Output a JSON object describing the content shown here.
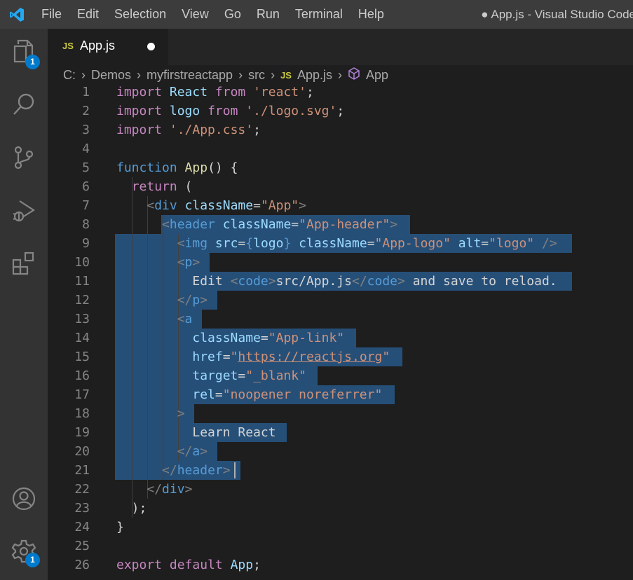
{
  "window": {
    "title": "● App.js - Visual Studio Code",
    "menu": [
      "File",
      "Edit",
      "Selection",
      "View",
      "Go",
      "Run",
      "Terminal",
      "Help"
    ]
  },
  "activity_bar": {
    "explorer_badge": "1",
    "settings_badge": "1",
    "icons": [
      "files-icon",
      "search-icon",
      "source-control-icon",
      "run-debug-icon",
      "extensions-icon",
      "account-icon",
      "gear-icon"
    ]
  },
  "tab": {
    "file_icon": "JS",
    "label": "App.js",
    "dirty": true
  },
  "breadcrumb": {
    "parts": [
      "C:",
      "Demos",
      "myfirstreactapp",
      "src"
    ],
    "file_icon": "JS",
    "file": "App.js",
    "symbol": "App"
  },
  "editor": {
    "selection_start_line": 8,
    "selection_end_line": 21,
    "lines": [
      {
        "n": "1"
      },
      {
        "n": "2"
      },
      {
        "n": "3"
      },
      {
        "n": "4"
      },
      {
        "n": "5"
      },
      {
        "n": "6"
      },
      {
        "n": "7"
      },
      {
        "n": "8"
      },
      {
        "n": "9"
      },
      {
        "n": "10"
      },
      {
        "n": "11"
      },
      {
        "n": "12"
      },
      {
        "n": "13"
      },
      {
        "n": "14"
      },
      {
        "n": "15"
      },
      {
        "n": "16"
      },
      {
        "n": "17"
      },
      {
        "n": "18"
      },
      {
        "n": "19"
      },
      {
        "n": "20"
      },
      {
        "n": "21"
      },
      {
        "n": "22"
      },
      {
        "n": "23"
      },
      {
        "n": "24"
      },
      {
        "n": "25"
      },
      {
        "n": "26"
      }
    ],
    "code": [
      [
        [
          "kw2",
          "import"
        ],
        [
          "txt",
          " "
        ],
        [
          "var",
          "React"
        ],
        [
          "txt",
          " "
        ],
        [
          "kw2",
          "from"
        ],
        [
          "txt",
          " "
        ],
        [
          "str",
          "'react'"
        ],
        [
          "pun",
          ";"
        ]
      ],
      [
        [
          "kw2",
          "import"
        ],
        [
          "txt",
          " "
        ],
        [
          "var",
          "logo"
        ],
        [
          "txt",
          " "
        ],
        [
          "kw2",
          "from"
        ],
        [
          "txt",
          " "
        ],
        [
          "str",
          "'./logo.svg'"
        ],
        [
          "pun",
          ";"
        ]
      ],
      [
        [
          "kw2",
          "import"
        ],
        [
          "txt",
          " "
        ],
        [
          "str",
          "'./App.css'"
        ],
        [
          "pun",
          ";"
        ]
      ],
      [],
      [
        [
          "kw",
          "function"
        ],
        [
          "txt",
          " "
        ],
        [
          "fn",
          "App"
        ],
        [
          "pun",
          "() {"
        ]
      ],
      [
        [
          "txt",
          "  "
        ],
        [
          "kw2",
          "return"
        ],
        [
          "txt",
          " ("
        ]
      ],
      [
        [
          "txt",
          "    "
        ],
        [
          "br",
          "<"
        ],
        [
          "tag",
          "div"
        ],
        [
          "txt",
          " "
        ],
        [
          "attr",
          "className"
        ],
        [
          "pun",
          "="
        ],
        [
          "str",
          "\"App\""
        ],
        [
          "br",
          ">"
        ]
      ],
      [
        [
          "txt",
          "      "
        ],
        [
          "br",
          "<"
        ],
        [
          "tag",
          "header"
        ],
        [
          "txt",
          " "
        ],
        [
          "attr",
          "className"
        ],
        [
          "pun",
          "="
        ],
        [
          "str",
          "\"App-header\""
        ],
        [
          "br",
          ">"
        ]
      ],
      [
        [
          "txt",
          "        "
        ],
        [
          "br",
          "<"
        ],
        [
          "tag",
          "img"
        ],
        [
          "txt",
          " "
        ],
        [
          "attr",
          "src"
        ],
        [
          "pun",
          "="
        ],
        [
          "kw",
          "{"
        ],
        [
          "var",
          "logo"
        ],
        [
          "kw",
          "}"
        ],
        [
          "txt",
          " "
        ],
        [
          "attr",
          "className"
        ],
        [
          "pun",
          "="
        ],
        [
          "str",
          "\"App-logo\""
        ],
        [
          "txt",
          " "
        ],
        [
          "attr",
          "alt"
        ],
        [
          "pun",
          "="
        ],
        [
          "str",
          "\"logo\""
        ],
        [
          "txt",
          " "
        ],
        [
          "br",
          "/>"
        ]
      ],
      [
        [
          "txt",
          "        "
        ],
        [
          "br",
          "<"
        ],
        [
          "tag",
          "p"
        ],
        [
          "br",
          ">"
        ]
      ],
      [
        [
          "txt",
          "          "
        ],
        [
          "txt",
          "Edit "
        ],
        [
          "br",
          "<"
        ],
        [
          "tag",
          "code"
        ],
        [
          "br",
          ">"
        ],
        [
          "txt",
          "src/App.js"
        ],
        [
          "br",
          "</"
        ],
        [
          "tag",
          "code"
        ],
        [
          "br",
          ">"
        ],
        [
          "txt",
          " and save to reload."
        ]
      ],
      [
        [
          "txt",
          "        "
        ],
        [
          "br",
          "</"
        ],
        [
          "tag",
          "p"
        ],
        [
          "br",
          ">"
        ]
      ],
      [
        [
          "txt",
          "        "
        ],
        [
          "br",
          "<"
        ],
        [
          "tag",
          "a"
        ]
      ],
      [
        [
          "txt",
          "          "
        ],
        [
          "attr",
          "className"
        ],
        [
          "pun",
          "="
        ],
        [
          "str",
          "\"App-link\""
        ]
      ],
      [
        [
          "txt",
          "          "
        ],
        [
          "attr",
          "href"
        ],
        [
          "pun",
          "="
        ],
        [
          "str",
          "\""
        ],
        [
          "url",
          "https://reactjs.org"
        ],
        [
          "str",
          "\""
        ]
      ],
      [
        [
          "txt",
          "          "
        ],
        [
          "attr",
          "target"
        ],
        [
          "pun",
          "="
        ],
        [
          "str",
          "\"_blank\""
        ]
      ],
      [
        [
          "txt",
          "          "
        ],
        [
          "attr",
          "rel"
        ],
        [
          "pun",
          "="
        ],
        [
          "str",
          "\"noopener noreferrer\""
        ]
      ],
      [
        [
          "txt",
          "        "
        ],
        [
          "br",
          ">"
        ]
      ],
      [
        [
          "txt",
          "          "
        ],
        [
          "txt",
          "Learn React"
        ]
      ],
      [
        [
          "txt",
          "        "
        ],
        [
          "br",
          "</"
        ],
        [
          "tag",
          "a"
        ],
        [
          "br",
          ">"
        ]
      ],
      [
        [
          "txt",
          "      "
        ],
        [
          "br",
          "</"
        ],
        [
          "tag",
          "header"
        ],
        [
          "br",
          ">"
        ]
      ],
      [
        [
          "txt",
          "    "
        ],
        [
          "br",
          "</"
        ],
        [
          "tag",
          "div"
        ],
        [
          "br",
          ">"
        ]
      ],
      [
        [
          "txt",
          "  );"
        ]
      ],
      [
        [
          "pun",
          "}"
        ]
      ],
      [],
      [
        [
          "kw2",
          "export"
        ],
        [
          "txt",
          " "
        ],
        [
          "kw2",
          "default"
        ],
        [
          "txt",
          " "
        ],
        [
          "var",
          "App"
        ],
        [
          "pun",
          ";"
        ]
      ]
    ]
  },
  "colors": {
    "accent": "#007acc",
    "selection": "#264f78",
    "js_icon": "#cbcb41",
    "symbol_icon": "#b180d7"
  }
}
